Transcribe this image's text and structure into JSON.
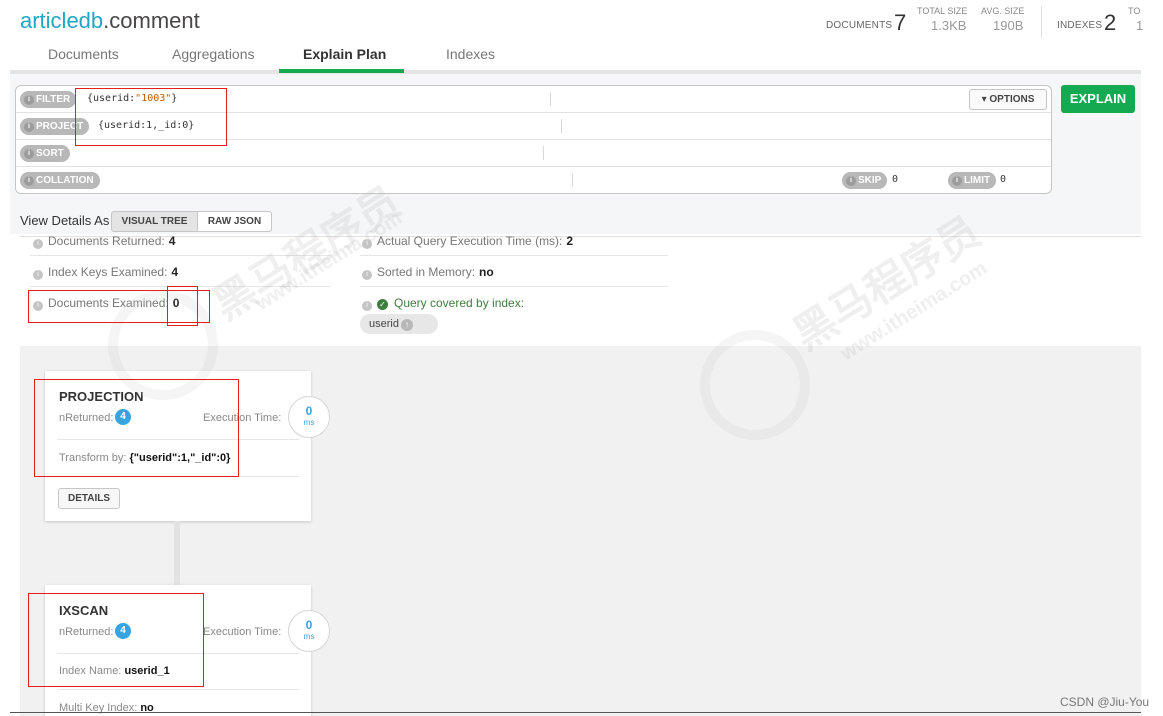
{
  "header": {
    "title_db": "articledb",
    "title_coll": ".comment",
    "documents_label": "DOCUMENTS",
    "documents_value": "7",
    "total_size_label": "TOTAL SIZE",
    "total_size_value": "1.3KB",
    "avg_size_label": "AVG. SIZE",
    "avg_size_value": "190B",
    "indexes_label": "INDEXES",
    "indexes_value": "2",
    "total_index_label_cut": "TO",
    "total_index_value_cut": "1"
  },
  "tabs": [
    {
      "label": "Documents"
    },
    {
      "label": "Aggregations"
    },
    {
      "label": "Explain Plan"
    },
    {
      "label": "Indexes"
    }
  ],
  "active_tab": "Explain Plan",
  "query": {
    "filter_label": "FILTER",
    "filter_key": "{userid:",
    "filter_str": "\"1003\"",
    "filter_end": "}",
    "project_label": "PROJECT",
    "project_value": "{userid:1,_id:0}",
    "sort_label": "SORT",
    "collation_label": "COLLATION",
    "skip_label": "SKIP",
    "skip_value": "0",
    "limit_label": "LIMIT",
    "limit_value": "0",
    "options_label": "▾ OPTIONS",
    "explain_label": "EXPLAIN"
  },
  "view": {
    "label": "View Details As",
    "visual_tree": "VISUAL TREE",
    "raw_json": "RAW JSON"
  },
  "summary": {
    "docs_returned_label": "Documents Returned:",
    "docs_returned_value": "4",
    "keys_examined_label": "Index Keys Examined:",
    "keys_examined_value": "4",
    "docs_examined_label": "Documents Examined:",
    "docs_examined_value": "0",
    "exec_time_label": "Actual Query Execution Time (ms):",
    "exec_time_value": "2",
    "sorted_label": "Sorted in Memory:",
    "sorted_value": "no",
    "covered_label": "Query covered by index:",
    "index_tag": "userid"
  },
  "stages": [
    {
      "name": "PROJECTION",
      "nreturned_label": "nReturned:",
      "nreturned_value": "4",
      "exec_label": "Execution Time:",
      "exec_value": "0",
      "exec_unit": "ms",
      "detail_label": "Transform by:",
      "detail_value": "{\"userid\":1,\"_id\":0}",
      "button": "DETAILS"
    },
    {
      "name": "IXSCAN",
      "nreturned_label": "nReturned:",
      "nreturned_value": "4",
      "exec_label": "Execution Time:",
      "exec_value": "0",
      "exec_unit": "ms",
      "detail_label": "Index Name:",
      "detail_value": "userid_1",
      "detail2_label": "Multi Key Index:",
      "detail2_value": "no"
    }
  ],
  "watermark": {
    "cn": "黑马程序员",
    "url": "www.itheima.com"
  },
  "credit": "CSDN @Jiu-You",
  "colors": {
    "accent_green": "#13aa52",
    "badge_blue": "#39a3e0",
    "annotation_red": "#e41d1d"
  }
}
